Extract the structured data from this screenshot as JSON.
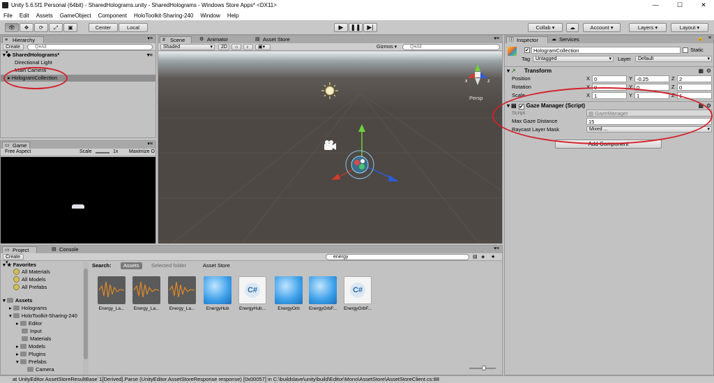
{
  "window": {
    "title": "Unity 5.6.5f1 Personal (64bit) - SharedHolograms.unity - SharedHolograms - Windows Store Apps* <DX11>"
  },
  "menu": [
    "File",
    "Edit",
    "Assets",
    "GameObject",
    "Component",
    "HoloToolkit-Sharing-240",
    "Window",
    "Help"
  ],
  "toolbar": {
    "pivot": "Center",
    "space": "Local",
    "collab": "Collab ▾",
    "account": "Account",
    "layers": "Layers",
    "layout": "Layout"
  },
  "hierarchy": {
    "tab": "Hierarchy",
    "create": "Create ▾",
    "search_placeholder": "Q▾All",
    "scene": "SharedHolograms*",
    "items": [
      "Directional Light",
      "Main Camera",
      "HologramCollection"
    ]
  },
  "scene": {
    "tabs": [
      "Scene",
      "Animator",
      "Asset Store"
    ],
    "shading": "Shaded",
    "mode2d": "2D",
    "gizmos": "Gizmos ▾",
    "search_placeholder": "Q▾All",
    "persp": "Persp",
    "axis_x": "x",
    "axis_z": "z"
  },
  "game": {
    "tab": "Game",
    "aspect": "Free Aspect",
    "scale_label": "Scale",
    "scale_value": "1x",
    "maximize": "Maximize O"
  },
  "inspector": {
    "tabs": [
      "Inspector",
      "Services"
    ],
    "object_name": "HologramCollection",
    "static_label": "Static",
    "tag_label": "Tag",
    "tag_value": "Untagged",
    "layer_label": "Layer",
    "layer_value": "Default",
    "transform": {
      "title": "Transform",
      "rows": [
        {
          "label": "Position",
          "x": "0",
          "y": "-0.25",
          "z": "2"
        },
        {
          "label": "Rotation",
          "x": "0",
          "y": "0",
          "z": "0"
        },
        {
          "label": "Scale",
          "x": "1",
          "y": "1",
          "z": "1"
        }
      ]
    },
    "gaze": {
      "title": "Gaze Manager (Script)",
      "script_label": "Script",
      "script_value": "GazeManager",
      "max_label": "Max Gaze Distance",
      "max_value": "15",
      "mask_label": "Raycast Layer Mask",
      "mask_value": "Mixed ..."
    },
    "add_component": "Add Component"
  },
  "project": {
    "tabs": [
      "Project",
      "Console"
    ],
    "create": "Create ▾",
    "search_value": "energy",
    "search_label": "Search:",
    "filters": [
      "Assets",
      "Selected folder",
      "Asset Store"
    ],
    "favorites": {
      "title": "Favorites",
      "items": [
        "All Materials",
        "All Models",
        "All Prefabs"
      ]
    },
    "assets": {
      "title": "Assets",
      "items": [
        "Holograms",
        "HoloToolkit-Sharing-240",
        "Editor",
        "Input",
        "Materials",
        "Models",
        "Plugins",
        "Prefabs",
        "Camera"
      ]
    },
    "results": [
      {
        "name": "Energy_La...",
        "kind": "audio"
      },
      {
        "name": "Energy_La...",
        "kind": "audio"
      },
      {
        "name": "Energy_La...",
        "kind": "audio"
      },
      {
        "name": "EnergyHub",
        "kind": "cube"
      },
      {
        "name": "EnergyHub...",
        "kind": "script"
      },
      {
        "name": "EnergyOrb",
        "kind": "cube"
      },
      {
        "name": "EnergyOrbF...",
        "kind": "cube"
      },
      {
        "name": "EnergyOrbF...",
        "kind": "script"
      }
    ]
  },
  "statusbar": "at UnityEditor.AssetStoreResultBase`1[Derived].Parse (UnityEditor.AssetStoreResponse response) [0x00057] in C:\\buildslave\\unity\\build\\Editor\\Mono\\AssetStore\\AssetStoreClient.cs:88",
  "colors": {
    "highlight_oval": "#d4202a",
    "scene_bg": "#4d4844",
    "game_bg": "#000000"
  }
}
